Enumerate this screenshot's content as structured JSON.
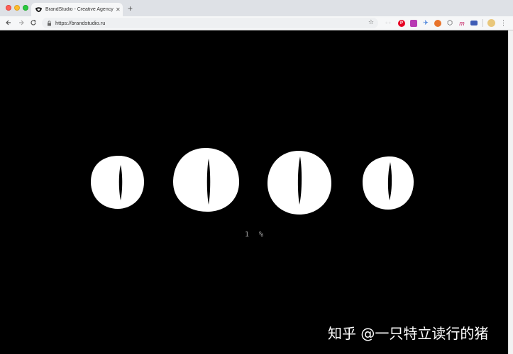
{
  "browser": {
    "tab_title": "BrandStudio - Creative Agency",
    "tab_close": "✕",
    "new_tab": "+",
    "url": "https://brandstudio.ru",
    "extensions": [
      "pinterest-icon",
      "extension-purple-icon",
      "extension-bird-icon",
      "extension-orange-icon",
      "extension-cube-icon",
      "extension-m-icon",
      "extension-blue-icon"
    ]
  },
  "page": {
    "loader_progress": "1 %",
    "watermark": "知乎 @一只特立读行的猪"
  },
  "colors": {
    "page_background": "#000000",
    "eye_color": "#ffffff",
    "pupil_color": "#000000"
  }
}
